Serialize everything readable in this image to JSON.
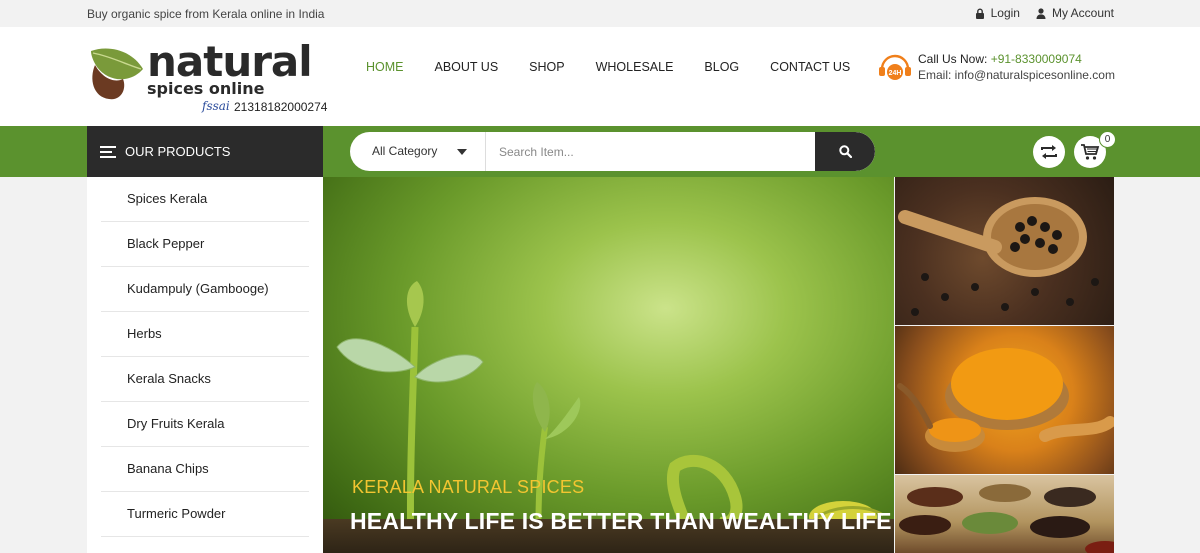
{
  "topbar": {
    "tagline": "Buy organic spice from Kerala online in India",
    "login": "Login",
    "my_account": "My Account"
  },
  "logo": {
    "word": "natural",
    "sub": "spices online",
    "fssai": "fssai",
    "license": "21318182000274"
  },
  "nav": {
    "items": [
      "HOME",
      "ABOUT US",
      "SHOP",
      "WHOLESALE",
      "BLOG",
      "CONTACT US"
    ],
    "active": "HOME"
  },
  "contact": {
    "badge": "24H",
    "call_label": "Call Us Now:",
    "phone": "+91-8330009074",
    "email": "Email: info@naturalspicesonline.com"
  },
  "greenbar": {
    "our_products": "OUR PRODUCTS",
    "category": "All Category",
    "search_placeholder": "Search Item...",
    "cart_count": "0"
  },
  "sidebar": {
    "items": [
      "Spices Kerala",
      "Black Pepper",
      "Kudampuly (Gambooge)",
      "Herbs",
      "Kerala Snacks",
      "Dry Fruits Kerala",
      "Banana Chips",
      "Turmeric Powder"
    ]
  },
  "hero": {
    "subtitle": "KERALA NATURAL SPICES",
    "title": "HEALTHY LIFE IS BETTER THAN WEALTHY LIFE"
  },
  "colors": {
    "brand_green": "#5b922e",
    "dark": "#2b2b2b",
    "hero_yellow": "#f3c531"
  }
}
